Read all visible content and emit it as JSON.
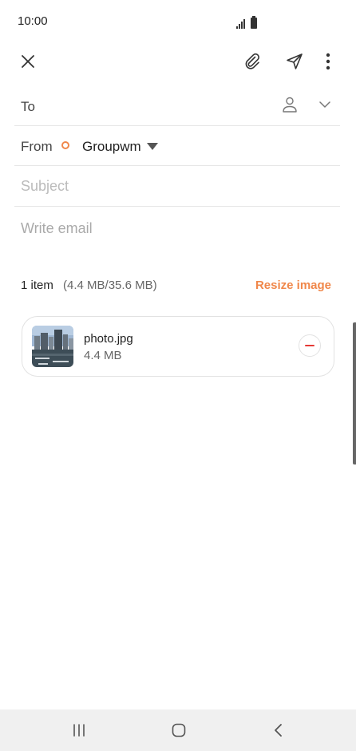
{
  "status_bar": {
    "time": "10:00"
  },
  "toolbar": {
    "close_icon": "close-icon",
    "attach_icon": "paperclip-icon",
    "send_icon": "send-icon",
    "more_icon": "more-vertical-icon"
  },
  "compose": {
    "to_label": "To",
    "from_label": "From",
    "from_account": "Groupwm",
    "subject_placeholder": "Subject",
    "body_placeholder": "Write email"
  },
  "attachments": {
    "count_label": "1 item",
    "size_label": "(4.4 MB/35.6 MB)",
    "resize_label": "Resize image",
    "items": [
      {
        "name": "photo.jpg",
        "size": "4.4 MB"
      }
    ]
  },
  "colors": {
    "accent": "#f0874a",
    "remove": "#e53935",
    "divider": "#e6e6e6",
    "nav_bg": "#f0f0f0"
  }
}
